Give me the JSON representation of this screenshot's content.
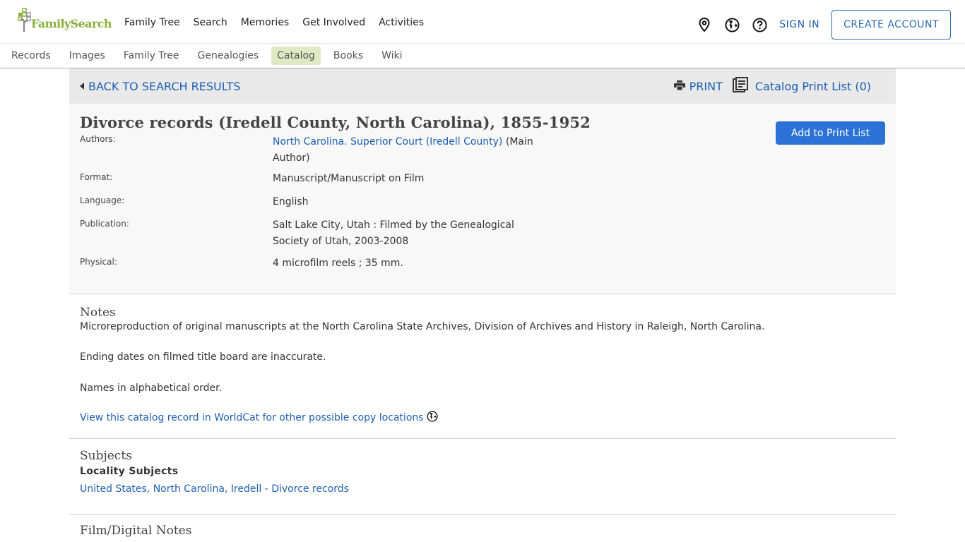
{
  "header": {
    "logo_text": "FamilySearch",
    "nav": [
      "Family Tree",
      "Search",
      "Memories",
      "Get Involved",
      "Activities"
    ],
    "icons": [
      "location-pin-icon",
      "globe-icon",
      "help-icon"
    ],
    "sign_in": "SIGN IN",
    "create_account": "CREATE ACCOUNT"
  },
  "subnav": {
    "items": [
      "Records",
      "Images",
      "Family Tree",
      "Genealogies",
      "Catalog",
      "Books",
      "Wiki"
    ],
    "active": "Catalog"
  },
  "backbar": {
    "back_label": "BACK TO SEARCH RESULTS",
    "print_label": "PRINT",
    "print_list_label": "Catalog Print List (0)"
  },
  "record": {
    "title": "Divorce records (Iredell County, North Carolina), 1855-1952",
    "add_button": "Add to Print List",
    "fields": {
      "authors_label": "Authors:",
      "authors_link": "North Carolina. Superior Court (Iredell County)",
      "authors_suffix": " (Main Author)",
      "format_label": "Format:",
      "format_value": "Manuscript/Manuscript on Film",
      "language_label": "Language:",
      "language_value": "English",
      "publication_label": "Publication:",
      "publication_value": "Salt Lake City, Utah : Filmed by the Genealogical Society of Utah, 2003-2008",
      "physical_label": "Physical:",
      "physical_value": "4 microfilm reels ; 35 mm."
    }
  },
  "notes": {
    "heading": "Notes",
    "paragraphs": [
      "Microreproduction of original manuscripts at the North Carolina State Archives, Division of Archives and History in Raleigh, North Carolina.",
      "Ending dates on filmed title board are inaccurate.",
      "Names in alphabetical order."
    ],
    "worldcat_link": "View this catalog record in WorldCat for other possible copy locations"
  },
  "subjects": {
    "heading": "Subjects",
    "subheading": "Locality Subjects",
    "link": "United States, North Carolina, Iredell - Divorce records"
  },
  "film": {
    "heading": "Film/Digital Notes"
  },
  "colors": {
    "link_blue": "#1d5fb3",
    "button_blue": "#2c72d6",
    "logo_green": "#87b13b",
    "active_tab_bg": "#dfeac4"
  }
}
